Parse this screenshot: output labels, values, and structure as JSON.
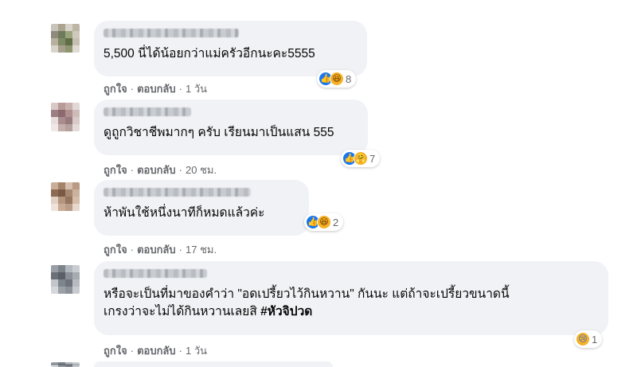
{
  "comments": [
    {
      "text_lines": [
        "5,500 นี่ได้น้อยกว่าแม่ครัวอีกนะคะ5555"
      ],
      "reactions": [
        "like",
        "haha"
      ],
      "reaction_count": "8",
      "like_label": "ถูกใจ",
      "reply_label": "ตอบกลับ",
      "time": "1 วัน",
      "avatar_colors": [
        "#c9c4b9",
        "#a9a390",
        "#d8d3c8",
        "#bdb6a6",
        "#8f8a7c",
        "#6f7a5a",
        "#9aa47c",
        "#cfc9bd",
        "#b7b09f",
        "#7d8a63",
        "#5f6d48",
        "#c6c0b2",
        "#d9d4ca",
        "#a69f8e",
        "#8e9670",
        "#e0dcd3"
      ]
    },
    {
      "text_lines": [
        "ดูถูกวิชาชีพมากๆ ครับ เรียนมาเป็นแสน 555"
      ],
      "reactions": [
        "like",
        "care"
      ],
      "reaction_count": "7",
      "like_label": "ถูกใจ",
      "reply_label": "ตอบกลับ",
      "time": "20 ชม.",
      "avatar_colors": [
        "#d6c9c6",
        "#b89a98",
        "#c8b2ae",
        "#e2d8d5",
        "#9c7f82",
        "#8a6a6e",
        "#b28f8f",
        "#cdbcb8",
        "#e7dedb",
        "#a98c8d",
        "#977a7c",
        "#d8cac7",
        "#efe8e6",
        "#c4afac",
        "#b5a09e",
        "#e4dad7"
      ]
    },
    {
      "text_lines": [
        "ห้าพันใช้หนึ่งนาทีก็หมดแล้วค่ะ"
      ],
      "reactions": [
        "like",
        "haha"
      ],
      "reaction_count": "2",
      "like_label": "ถูกใจ",
      "reply_label": "ตอบกลับ",
      "time": "17 ชม.",
      "avatar_colors": [
        "#c8ad98",
        "#a5836b",
        "#d6bfae",
        "#b99a84",
        "#8d6a52",
        "#7a5a45",
        "#a6876f",
        "#cbb29f",
        "#e1d1c4",
        "#b49580",
        "#957560",
        "#d4bda9",
        "#efe3d9",
        "#c7ab95",
        "#b89c87",
        "#e6d8cc"
      ]
    },
    {
      "text_lines": [
        "หรือจะเป็นที่มาของคำว่า \"อดเปรี้ยวไว้กินหวาน\" กันนะ แต่ถ้าจะเปรี้ยวขนาดนี้",
        "เกรงว่าจะไม่ได้กินหวานเลยสิ"
      ],
      "hashtag": "#หัวจิปวด",
      "reactions": [
        "sad"
      ],
      "reaction_count": "1",
      "like_label": "ถูกใจ",
      "reply_label": "ตอบกลับ",
      "time": "1 วัน",
      "avatar_colors": [
        "#9a9fa6",
        "#7d838b",
        "#b3b8be",
        "#c9cdd2",
        "#6c7179",
        "#5b6068",
        "#8b9098",
        "#a6abb2",
        "#c2c6cb",
        "#7f858d",
        "#6e737b",
        "#b7bbc1",
        "#d4d7db",
        "#9ca1a8",
        "#8c9199",
        "#c8cbd0"
      ]
    }
  ]
}
